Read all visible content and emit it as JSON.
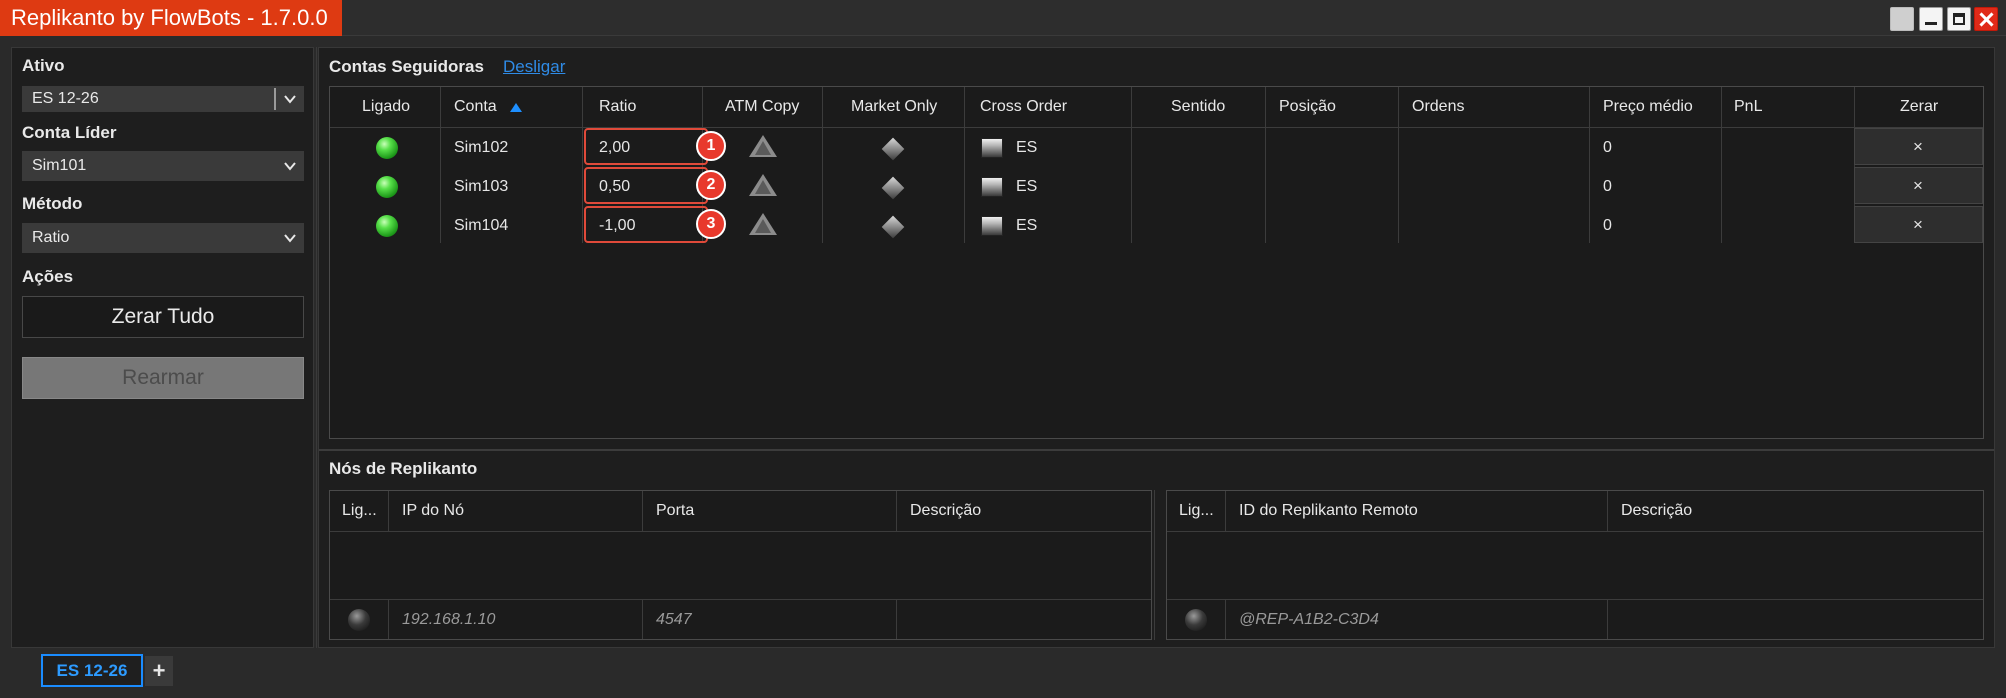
{
  "window": {
    "title": "Replikanto by FlowBots - 1.7.0.0"
  },
  "left": {
    "ativo_label": "Ativo",
    "ativo_value": "ES 12-26",
    "conta_lider_label": "Conta Líder",
    "conta_lider_value": "Sim101",
    "metodo_label": "Método",
    "metodo_value": "Ratio",
    "acoes_label": "Ações",
    "zerar_tudo": "Zerar Tudo",
    "rearmar": "Rearmar"
  },
  "followers": {
    "title": "Contas Seguidoras",
    "link": "Desligar",
    "columns": [
      "Ligado",
      "Conta",
      "Ratio",
      "ATM Copy",
      "Market Only",
      "Cross Order",
      "Sentido",
      "Posição",
      "Ordens",
      "Preço médio",
      "PnL",
      "Zerar"
    ],
    "rows": [
      {
        "conta": "Sim102",
        "ratio": "2,00",
        "cross": "ES",
        "preco": "0",
        "badge": "1",
        "zerar": "×"
      },
      {
        "conta": "Sim103",
        "ratio": "0,50",
        "cross": "ES",
        "preco": "0",
        "badge": "2",
        "zerar": "×"
      },
      {
        "conta": "Sim104",
        "ratio": "-1,00",
        "cross": "ES",
        "preco": "0",
        "badge": "3",
        "zerar": "×"
      }
    ]
  },
  "nodes": {
    "title": "Nós de Replikanto",
    "left_columns": [
      "Lig...",
      "IP do Nó",
      "Porta",
      "Descrição"
    ],
    "left_row": {
      "ip": "192.168.1.10",
      "porta": "4547"
    },
    "right_columns": [
      "Lig...",
      "ID do Replikanto Remoto",
      "Descrição"
    ],
    "right_row": {
      "id": "@REP-A1B2-C3D4"
    }
  },
  "tabs": {
    "active": "ES 12-26",
    "add": "+"
  },
  "colors": {
    "accent": "#de3a12",
    "link": "#2f8be6",
    "tab_active": "#1a8cff",
    "led_on": "#3ccf2e",
    "highlight": "#e04a3a"
  }
}
